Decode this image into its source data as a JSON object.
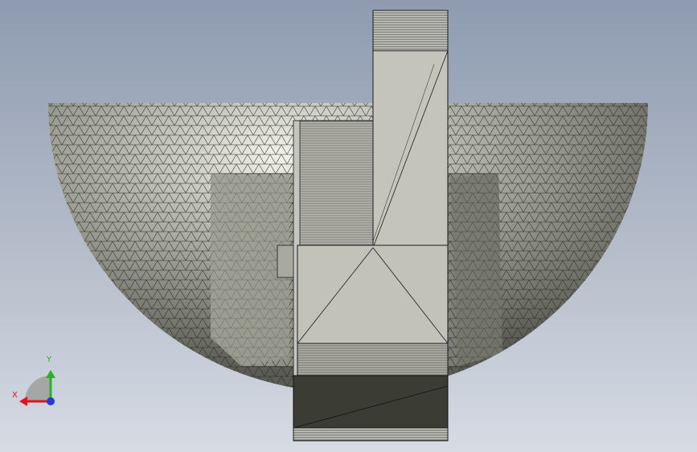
{
  "viewport": {
    "background_top": "#8e9bb0",
    "background_bottom": "#d6dbe4"
  },
  "model": {
    "shell_color": "#9a9b8f",
    "shell_highlight": "#f2f2e8",
    "mesh_color": "#2b2b2b",
    "shaft_color": "#c8c8c0",
    "base_color": "#3b3d35"
  },
  "triad": {
    "x_label": "X",
    "y_label": "Y",
    "x_color": "#e0141e",
    "y_color": "#22b422",
    "z_color": "#1e3cdc"
  }
}
